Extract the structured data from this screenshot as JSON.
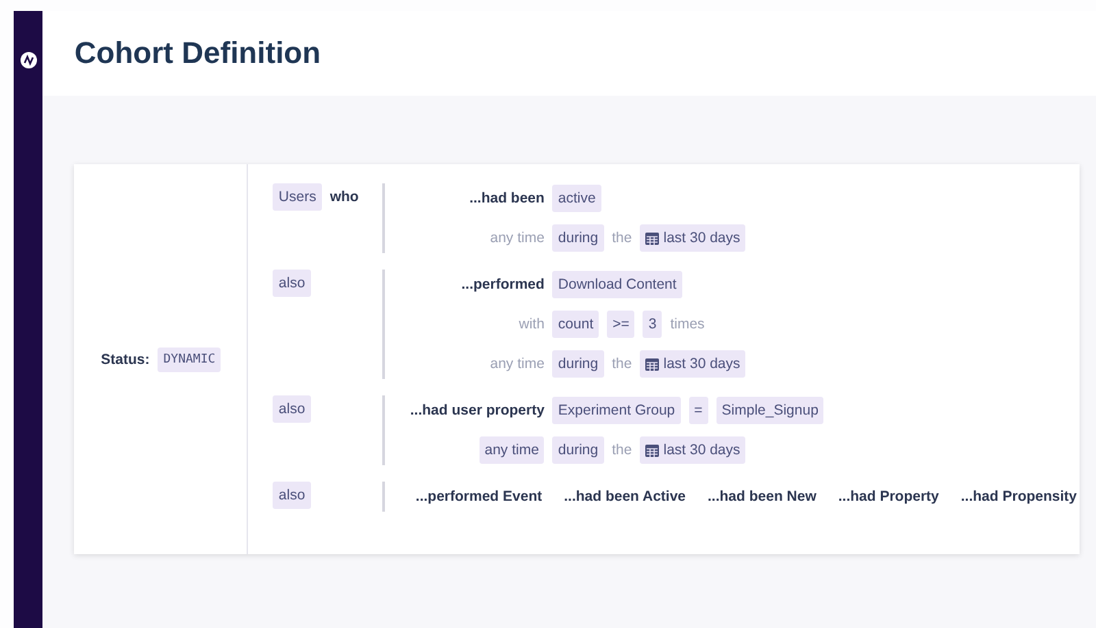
{
  "page": {
    "title": "Cohort Definition"
  },
  "status": {
    "label": "Status:",
    "value": "DYNAMIC"
  },
  "groups": [
    {
      "connector": [
        {
          "text": "Users",
          "kind": "token"
        },
        {
          "text": "who",
          "kind": "bold"
        }
      ],
      "lines": [
        {
          "lead": {
            "text": "...had been",
            "kind": "bold"
          },
          "items": [
            {
              "text": "active",
              "kind": "token"
            }
          ]
        },
        {
          "lead": {
            "text": "any time",
            "kind": "muted"
          },
          "items": [
            {
              "text": "during",
              "kind": "token"
            },
            {
              "text": "the",
              "kind": "muted"
            },
            {
              "text": "last 30 days",
              "kind": "date"
            }
          ]
        }
      ]
    },
    {
      "connector": [
        {
          "text": "also",
          "kind": "token"
        }
      ],
      "lines": [
        {
          "lead": {
            "text": "...performed",
            "kind": "bold"
          },
          "items": [
            {
              "text": "Download Content",
              "kind": "token"
            }
          ]
        },
        {
          "lead": {
            "text": "with",
            "kind": "muted"
          },
          "items": [
            {
              "text": "count",
              "kind": "token"
            },
            {
              "text": ">=",
              "kind": "token"
            },
            {
              "text": "3",
              "kind": "token"
            },
            {
              "text": "times",
              "kind": "muted"
            }
          ]
        },
        {
          "lead": {
            "text": "any time",
            "kind": "muted"
          },
          "items": [
            {
              "text": "during",
              "kind": "token"
            },
            {
              "text": "the",
              "kind": "muted"
            },
            {
              "text": "last 30 days",
              "kind": "date"
            }
          ]
        }
      ]
    },
    {
      "connector": [
        {
          "text": "also",
          "kind": "token"
        }
      ],
      "lines": [
        {
          "lead": {
            "text": "...had user property",
            "kind": "bold"
          },
          "items": [
            {
              "text": "Experiment Group",
              "kind": "token"
            },
            {
              "text": "=",
              "kind": "token"
            },
            {
              "text": "Simple_Signup",
              "kind": "token"
            }
          ]
        },
        {
          "lead": {
            "text": "any time",
            "kind": "token"
          },
          "items": [
            {
              "text": "during",
              "kind": "token"
            },
            {
              "text": "the",
              "kind": "muted"
            },
            {
              "text": "last 30 days",
              "kind": "date"
            }
          ]
        }
      ]
    }
  ],
  "add_row": {
    "connector": {
      "text": "also"
    },
    "options": [
      "...performed Event",
      "...had been Active",
      "...had been New",
      "...had Property",
      "...had Propensity"
    ]
  }
}
